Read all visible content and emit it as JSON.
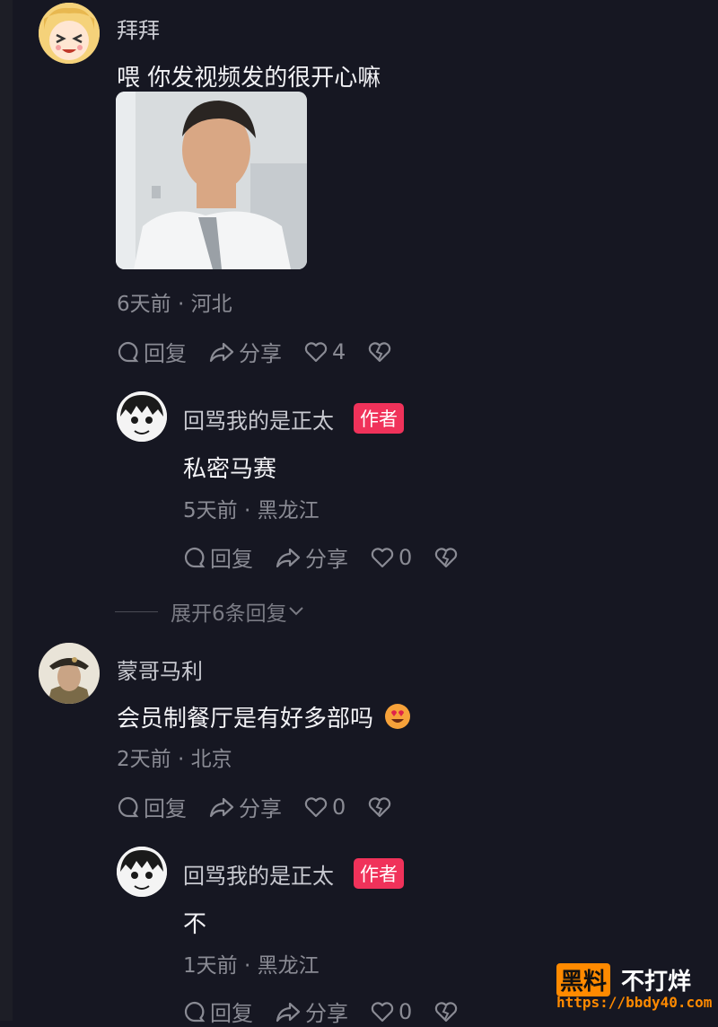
{
  "comments": [
    {
      "user": "拜拜",
      "text": "喂 你发视频发的很开心嘛",
      "meta": "6天前 · 河北",
      "reply_label": "回复",
      "share_label": "分享",
      "likes": "4",
      "reply": {
        "user": "回骂我的是正太",
        "badge": "作者",
        "text": "私密马赛",
        "meta": "5天前 · 黑龙江",
        "reply_label": "回复",
        "share_label": "分享",
        "likes": "0"
      },
      "expand_label": "展开6条回复"
    },
    {
      "user": "蒙哥马利",
      "text": "会员制餐厅是有好多部吗",
      "meta": "2天前 · 北京",
      "reply_label": "回复",
      "share_label": "分享",
      "likes": "0",
      "reply": {
        "user": "回骂我的是正太",
        "badge": "作者",
        "text": "不",
        "meta": "1天前 · 黑龙江",
        "reply_label": "回复",
        "share_label": "分享",
        "likes": "0"
      }
    }
  ],
  "watermark": {
    "box": "黑料",
    "text": "不打烊",
    "url": "https://bbdy40.com"
  },
  "colors": {
    "background": "#161722",
    "author_badge": "#f0325a",
    "watermark_accent": "#ff8a00"
  }
}
